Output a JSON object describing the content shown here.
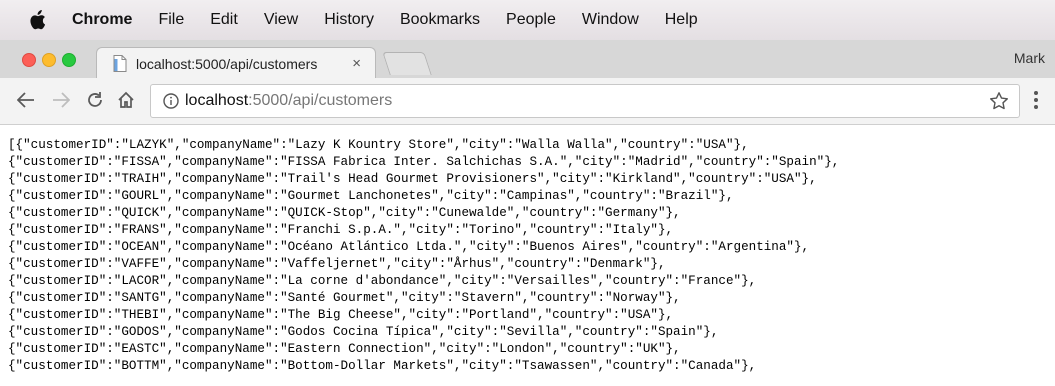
{
  "menubar": {
    "app": "Chrome",
    "items": [
      "File",
      "Edit",
      "View",
      "History",
      "Bookmarks",
      "People",
      "Window",
      "Help"
    ]
  },
  "tab": {
    "title": "localhost:5000/api/customers",
    "close": "×"
  },
  "profile": "Mark",
  "address": {
    "host": "localhost",
    "path": ":5000/api/customers"
  },
  "body_lines": [
    "[{\"customerID\":\"LAZYK\",\"companyName\":\"Lazy K Kountry Store\",\"city\":\"Walla Walla\",\"country\":\"USA\"},",
    "{\"customerID\":\"FISSA\",\"companyName\":\"FISSA Fabrica Inter. Salchichas S.A.\",\"city\":\"Madrid\",\"country\":\"Spain\"},",
    "{\"customerID\":\"TRAIH\",\"companyName\":\"Trail's Head Gourmet Provisioners\",\"city\":\"Kirkland\",\"country\":\"USA\"},",
    "{\"customerID\":\"GOURL\",\"companyName\":\"Gourmet Lanchonetes\",\"city\":\"Campinas\",\"country\":\"Brazil\"},",
    "{\"customerID\":\"QUICK\",\"companyName\":\"QUICK-Stop\",\"city\":\"Cunewalde\",\"country\":\"Germany\"},",
    "{\"customerID\":\"FRANS\",\"companyName\":\"Franchi S.p.A.\",\"city\":\"Torino\",\"country\":\"Italy\"},",
    "{\"customerID\":\"OCEAN\",\"companyName\":\"Océano Atlántico Ltda.\",\"city\":\"Buenos Aires\",\"country\":\"Argentina\"},",
    "{\"customerID\":\"VAFFE\",\"companyName\":\"Vaffeljernet\",\"city\":\"Århus\",\"country\":\"Denmark\"},",
    "{\"customerID\":\"LACOR\",\"companyName\":\"La corne d'abondance\",\"city\":\"Versailles\",\"country\":\"France\"},",
    "{\"customerID\":\"SANTG\",\"companyName\":\"Santé Gourmet\",\"city\":\"Stavern\",\"country\":\"Norway\"},",
    "{\"customerID\":\"THEBI\",\"companyName\":\"The Big Cheese\",\"city\":\"Portland\",\"country\":\"USA\"},",
    "{\"customerID\":\"GODOS\",\"companyName\":\"Godos Cocina Típica\",\"city\":\"Sevilla\",\"country\":\"Spain\"},",
    "{\"customerID\":\"EASTC\",\"companyName\":\"Eastern Connection\",\"city\":\"London\",\"country\":\"UK\"},",
    "{\"customerID\":\"BOTTM\",\"companyName\":\"Bottom-Dollar Markets\",\"city\":\"Tsawassen\",\"country\":\"Canada\"},"
  ]
}
